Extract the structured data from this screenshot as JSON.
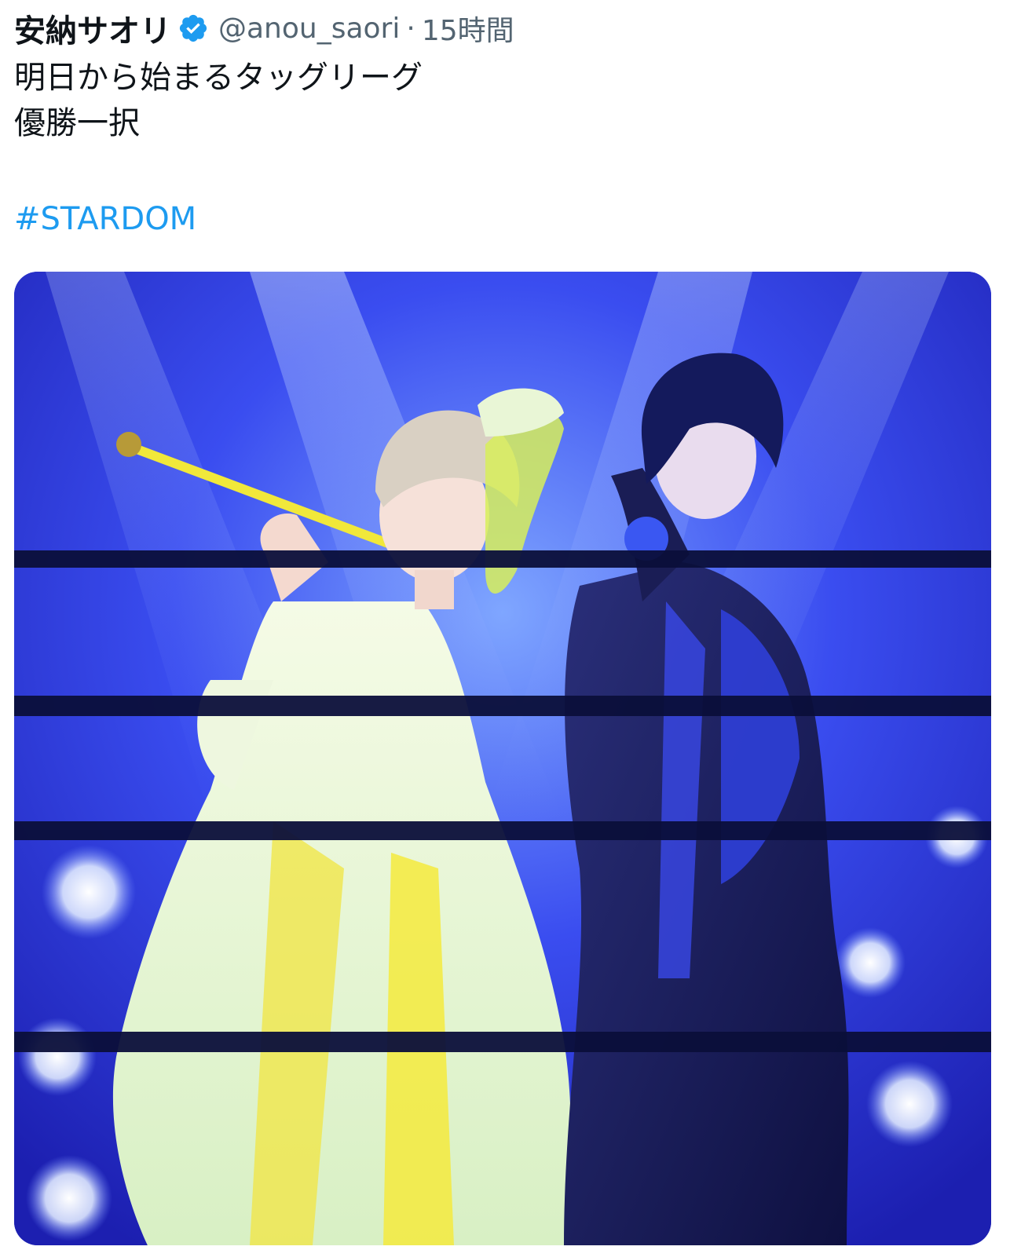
{
  "tweet": {
    "display_name": "安納サオリ",
    "handle": "@anou_saori",
    "separator": "·",
    "timestamp": "15時間",
    "verified_icon": "verified-badge-icon",
    "text_lines": [
      "明日から始まるタッグリーグ",
      "優勝一択"
    ],
    "hashtag": "#STARDOM"
  },
  "colors": {
    "text": "#0f1419",
    "muted": "#536471",
    "link": "#1d9bf0",
    "verified": "#1d9bf0"
  },
  "media": {
    "kind": "photo",
    "content": "two-wrestlers-in-ring-photo"
  }
}
